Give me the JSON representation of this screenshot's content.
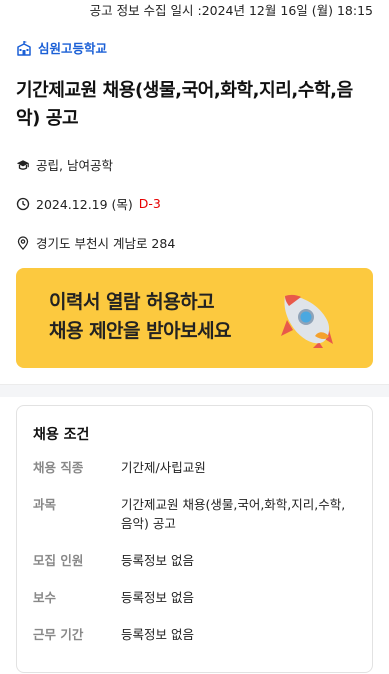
{
  "topbar": {
    "collected_label": "공고 정보 수집 일시 :2024년 12월 16일 (월) 18:15"
  },
  "school": {
    "name": "심원고등학교",
    "icon": "school-icon",
    "accent_color": "#1a5fd6"
  },
  "posting": {
    "title": "기간제교원 채용(생물,국어,화학,지리,수학,음악) 공고",
    "type": "공립, 남여공학",
    "date": "2024.12.19 (목)",
    "dday": "D-3",
    "dday_color": "#e60000",
    "address": "경기도 부천시 계남로 284"
  },
  "banner": {
    "line1": "이력서 열람 허용하고",
    "line2": "채용 제안을 받아보세요",
    "icon": "rocket-icon",
    "background": "#fcc93f"
  },
  "conditions": {
    "title": "채용 조건",
    "rows": [
      {
        "label": "채용 직종",
        "value": "기간제/사립교원"
      },
      {
        "label": "과목",
        "value": "기간제교원 채용(생물,국어,화학,지리,수학,음악) 공고"
      },
      {
        "label": "모집 인원",
        "value": "등록정보 없음"
      },
      {
        "label": "보수",
        "value": "등록정보 없음"
      },
      {
        "label": "근무 기간",
        "value": "등록정보 없음"
      }
    ]
  }
}
